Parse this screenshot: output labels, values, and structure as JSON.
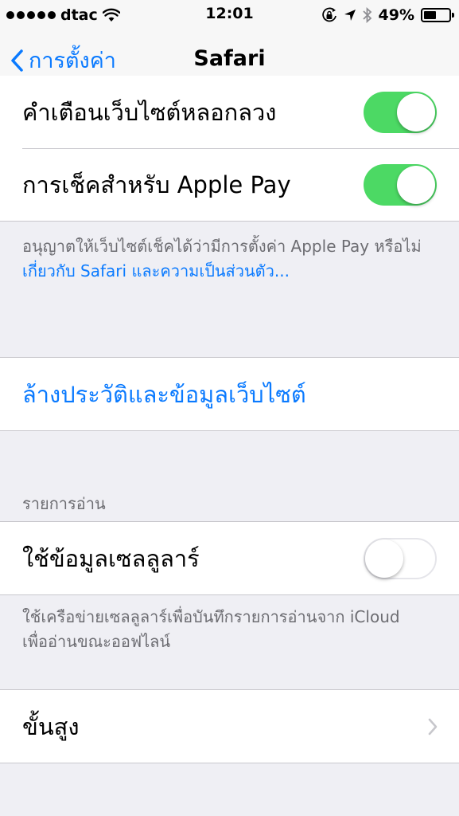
{
  "status_bar": {
    "carrier": "dtac",
    "time": "12:01",
    "battery_percent": "49%",
    "battery_level": 0.49,
    "signal_bars": 5,
    "icons": [
      "wifi-icon",
      "orientation-lock-icon",
      "location-icon",
      "bluetooth-icon",
      "battery-icon"
    ]
  },
  "nav": {
    "back_label": "การตั้งค่า",
    "title": "Safari"
  },
  "security": {
    "fraud_warning_label": "คำเตือนเว็บไซต์หลอกลวง",
    "fraud_warning_on": true,
    "apple_pay_label": "การเช็คสำหรับ Apple Pay",
    "apple_pay_on": true,
    "footer": "อนุญาตให้เว็บไซต์เช็คได้ว่ามีการตั้งค่า Apple Pay หรือไม่",
    "footer_link": "เกี่ยวกับ Safari และความเป็นส่วนตัว..."
  },
  "clear_history": {
    "label": "ล้างประวัติและข้อมูลเว็บไซต์"
  },
  "reading_list": {
    "header": "รายการอ่าน",
    "cellular_label": "ใช้ข้อมูลเซลลูลาร์",
    "cellular_on": false,
    "footer": "ใช้เครือข่ายเซลลูลาร์เพื่อบันทึกรายการอ่านจาก iCloud เพื่ออ่านขณะออฟไลน์"
  },
  "advanced": {
    "label": "ขั้นสูง"
  },
  "colors": {
    "accent": "#0a7aff",
    "toggle_on": "#4cd964",
    "background": "#efeff4"
  }
}
